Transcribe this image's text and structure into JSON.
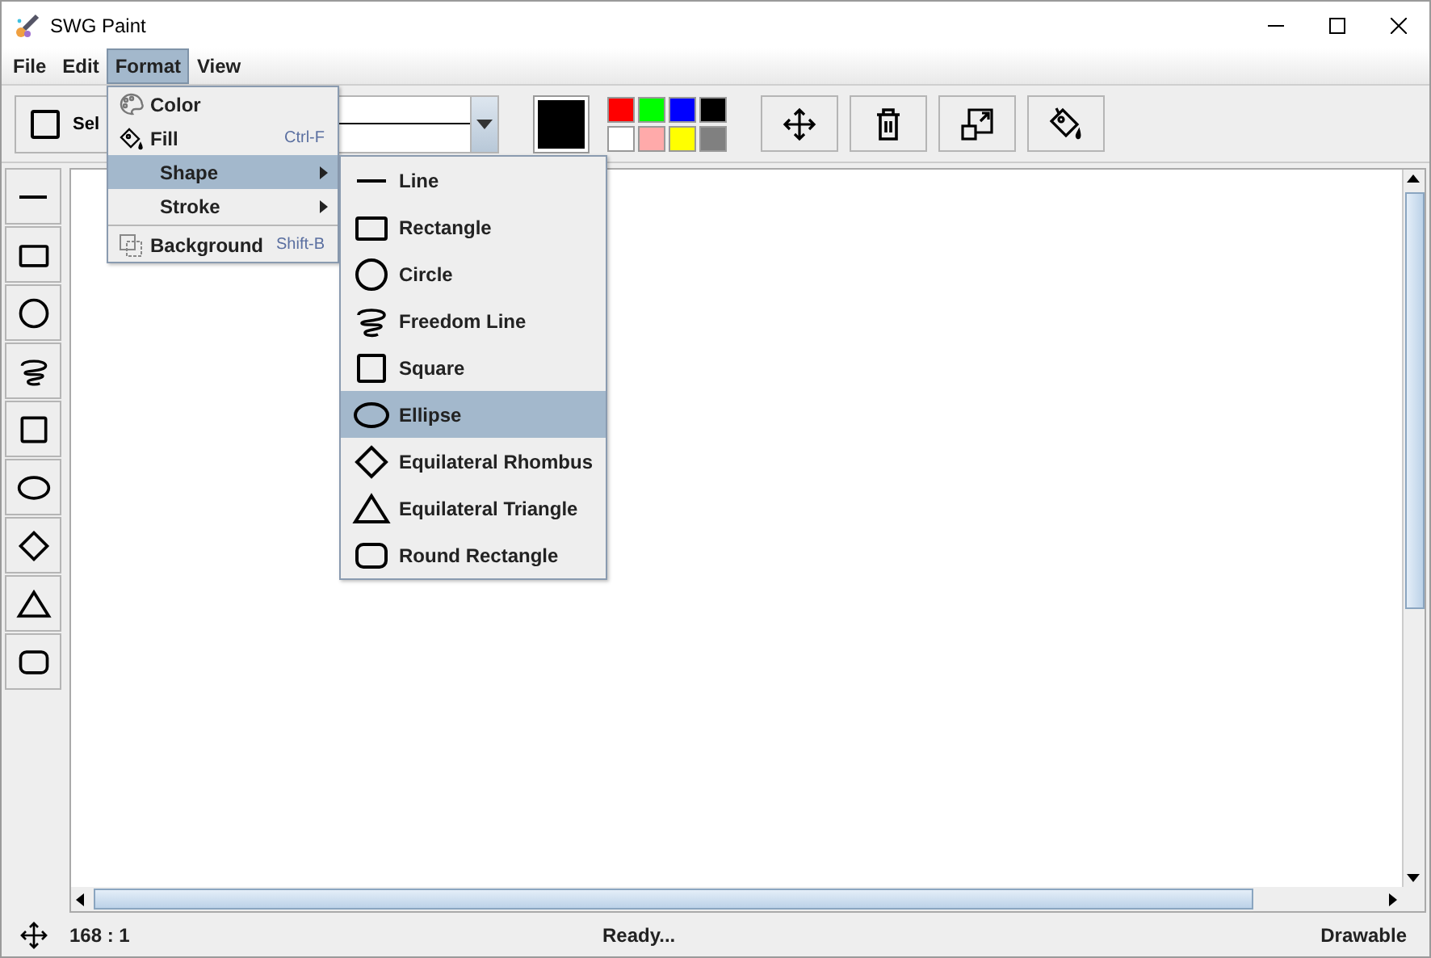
{
  "window": {
    "title": "SWG Paint"
  },
  "menu_bar": [
    {
      "label": "File",
      "selected": false
    },
    {
      "label": "Edit",
      "selected": false
    },
    {
      "label": "Format",
      "selected": true
    },
    {
      "label": "View",
      "selected": false
    }
  ],
  "toolbar": {
    "shape_button": {
      "label": "Sel"
    },
    "current_color": {
      "color": "#000000"
    },
    "palette": [
      {
        "color": "#ff0000"
      },
      {
        "color": "#00ff00"
      },
      {
        "color": "#0000ff"
      },
      {
        "color": "#000000"
      },
      {
        "color": "#ffffff"
      },
      {
        "color": "#ffaaaa"
      },
      {
        "color": "#ffff00"
      },
      {
        "color": "#808080"
      }
    ],
    "actions": [
      {
        "kind": "move"
      },
      {
        "kind": "delete"
      },
      {
        "kind": "resize"
      },
      {
        "kind": "fill"
      }
    ]
  },
  "shape_tools": [
    {
      "kind": "line"
    },
    {
      "kind": "rectangle"
    },
    {
      "kind": "circle"
    },
    {
      "kind": "freedom"
    },
    {
      "kind": "square"
    },
    {
      "kind": "ellipse"
    },
    {
      "kind": "rhombus"
    },
    {
      "kind": "triangle"
    },
    {
      "kind": "round_rectangle"
    }
  ],
  "format_menu": {
    "items": [
      {
        "kind": "color",
        "label": "Color",
        "selected": false
      },
      {
        "kind": "fill",
        "label": "Fill",
        "shortcut": "Ctrl-F",
        "selected": false
      },
      {
        "kind": "submenu",
        "label": "Shape",
        "selected": true
      },
      {
        "kind": "submenu",
        "label": "Stroke",
        "selected": false
      },
      {
        "kind": "separator"
      },
      {
        "kind": "background",
        "label": "Background",
        "shortcut": "Shift-B",
        "selected": false
      }
    ]
  },
  "shape_menu": {
    "items": [
      {
        "kind": "line",
        "label": "Line",
        "selected": false
      },
      {
        "kind": "rectangle",
        "label": "Rectangle",
        "selected": false
      },
      {
        "kind": "circle",
        "label": "Circle",
        "selected": false
      },
      {
        "kind": "freedom",
        "label": "Freedom Line",
        "selected": false
      },
      {
        "kind": "square",
        "label": "Square",
        "selected": false
      },
      {
        "kind": "ellipse",
        "label": "Ellipse",
        "selected": true
      },
      {
        "kind": "rhombus",
        "label": "Equilateral Rhombus",
        "selected": false
      },
      {
        "kind": "triangle",
        "label": "Equilateral Triangle",
        "selected": false
      },
      {
        "kind": "round_rectangle",
        "label": "Round Rectangle",
        "selected": false
      }
    ]
  },
  "status_bar": {
    "position": "168 : 1",
    "message": "Ready...",
    "mode": "Drawable"
  }
}
